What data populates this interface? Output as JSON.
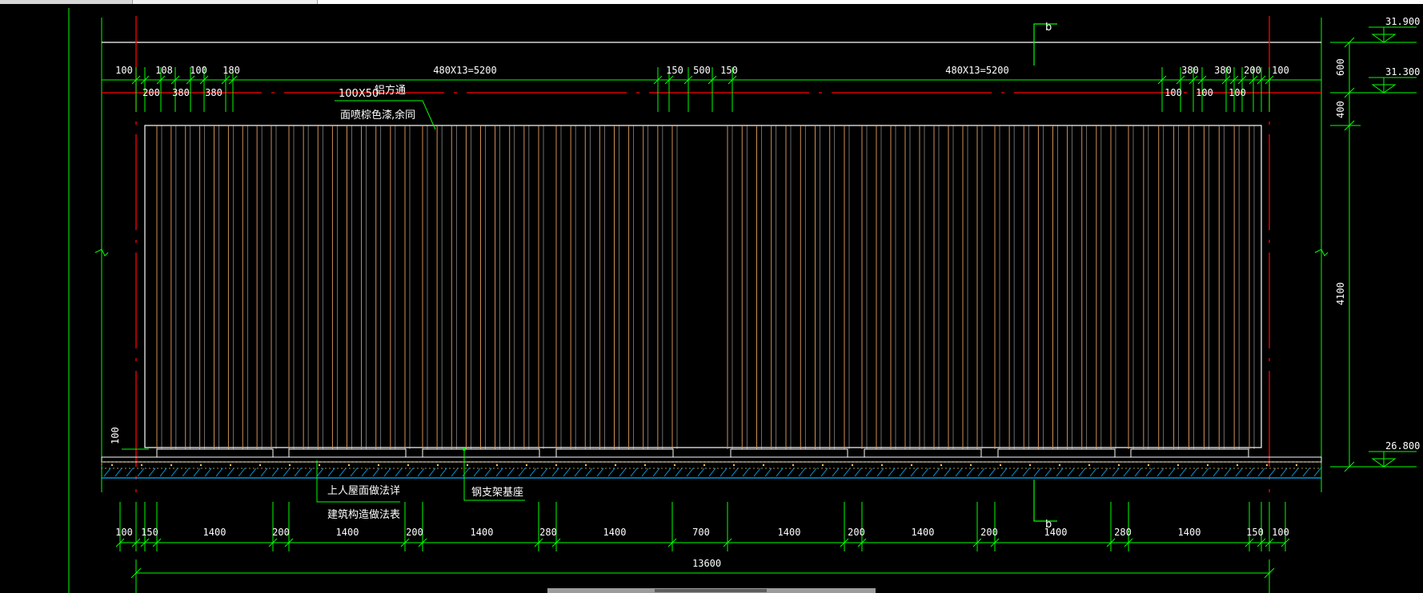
{
  "window": {
    "top_bar": "",
    "scrollbar": "horizontal"
  },
  "drawing": {
    "section_mark_top": "b",
    "section_mark_bottom": "b",
    "top_dims_row1": [
      "100",
      "108",
      "100",
      "180",
      "480X13=5200",
      "150",
      "500",
      "150",
      "480X13=5200",
      "380",
      "380",
      "200",
      "100"
    ],
    "top_dims_row2": [
      "200",
      "380",
      "380",
      "100",
      "100",
      "100"
    ],
    "annotations": {
      "member_size": "100X50",
      "member_name": "铝方通",
      "finish": "面喷棕色漆",
      "finish_rest": ",余同",
      "roof_ref_1": "上人屋面做法详",
      "roof_ref_2": "建筑构造做法表",
      "steel_base": "钢支架基座",
      "base_offset": "100"
    },
    "right_dims": [
      "600",
      "400",
      "4100"
    ],
    "elevations": [
      "31.900",
      "31.300",
      "26.800"
    ],
    "bottom_dims": [
      "100",
      "150",
      "1400",
      "200",
      "1400",
      "200",
      "1400",
      "280",
      "1400",
      "700",
      "1400",
      "200",
      "1400",
      "200",
      "1400",
      "280",
      "1400",
      "150",
      "100"
    ],
    "total_dim": "13600",
    "colors": {
      "background": "#000000",
      "dimension_lines": "#00ff00",
      "axis_lines": "#ff0000",
      "frame": "#ffffff",
      "slats": "#e8a060",
      "hatch": "#00b4ff"
    }
  }
}
